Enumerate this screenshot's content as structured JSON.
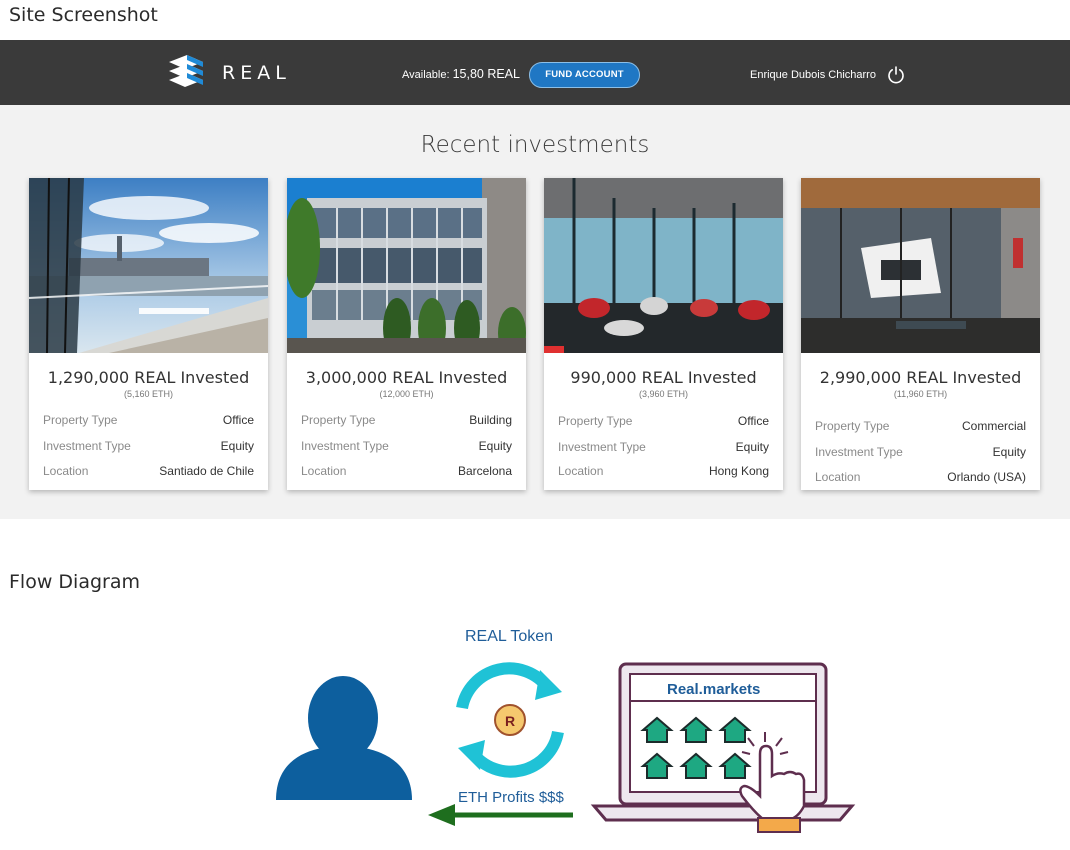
{
  "headings": {
    "site": "Site Screenshot",
    "flow": "Flow Diagram"
  },
  "topbar": {
    "logo_text": "REAL",
    "available_label": "Available:",
    "available_value": "15,80 REAL",
    "fund_button": "FUND ACCOUNT",
    "username": "Enrique Dubois Chicharro"
  },
  "main": {
    "title": "Recent investments",
    "labels": {
      "property_type": "Property Type",
      "investment_type": "Investment Type",
      "location": "Location"
    },
    "cards": [
      {
        "amount": "1,290,000 REAL Invested",
        "eth": "(5,160 ETH)",
        "property_type": "Office",
        "investment_type": "Equity",
        "location": "Santiado de Chile"
      },
      {
        "amount": "3,000,000 REAL Invested",
        "eth": "(12,000 ETH)",
        "property_type": "Building",
        "investment_type": "Equity",
        "location": "Barcelona"
      },
      {
        "amount": "990,000 REAL Invested",
        "eth": "(3,960 ETH)",
        "property_type": "Office",
        "investment_type": "Equity",
        "location": "Hong Kong"
      },
      {
        "amount": "2,990,000 REAL Invested",
        "eth": "(11,960 ETH)",
        "property_type": "Commercial",
        "investment_type": "Equity",
        "location": "Orlando (USA)"
      }
    ]
  },
  "flow": {
    "token_label": "REAL Token",
    "token_symbol": "R",
    "profits_label": "ETH Profits $$$",
    "market_label": "Real.markets"
  },
  "colors": {
    "topbar": "#3a3a3a",
    "accent_blue": "#1f77c4",
    "person_blue": "#0d5f9e",
    "cycle_cyan": "#1fc2d6",
    "arrow_green": "#1e6e1e",
    "house_green": "#1ea882"
  },
  "icons": [
    "real-logo-icon",
    "power-icon",
    "person-icon",
    "cycle-arrows-icon",
    "laptop-icon",
    "house-icon",
    "pointing-hand-icon"
  ]
}
